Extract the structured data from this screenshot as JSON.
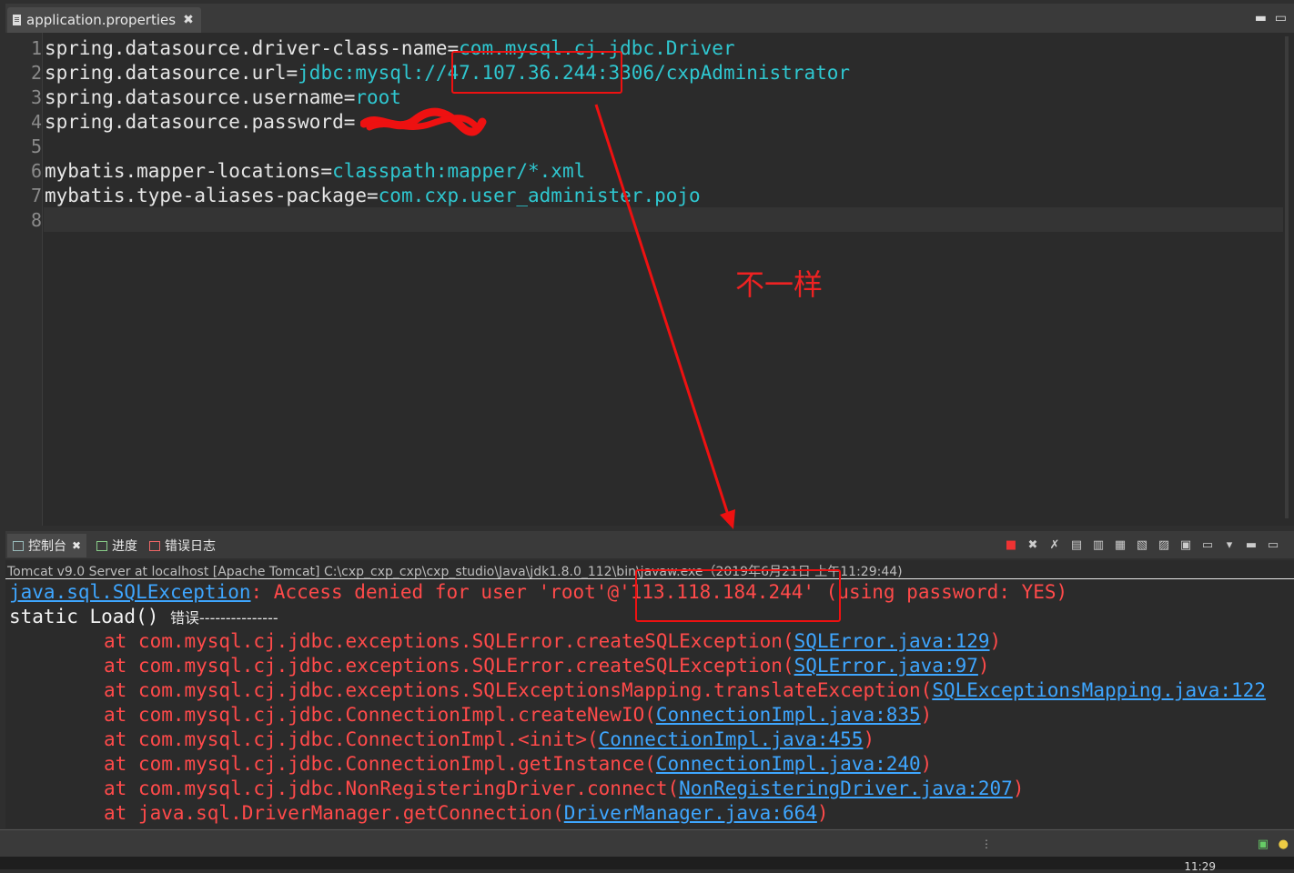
{
  "editor": {
    "tab_label": "application.properties",
    "tab_close": "✖",
    "lines": [
      {
        "num": "1",
        "key": "spring.datasource.driver-class-name=",
        "value": "com.mysql.cj.jdbc.Driver"
      },
      {
        "num": "2",
        "key": "spring.datasource.url=",
        "value": "jdbc:mysql://47.107.36.244:3306/cxpAdministrator"
      },
      {
        "num": "3",
        "key": "spring.datasource.username=",
        "value": "root"
      },
      {
        "num": "4",
        "key": "spring.datasource.password=",
        "value": ""
      },
      {
        "num": "5",
        "key": "",
        "value": ""
      },
      {
        "num": "6",
        "key": "mybatis.mapper-locations=",
        "value": "classpath:mapper/*.xml"
      },
      {
        "num": "7",
        "key": "mybatis.type-aliases-package=",
        "value": "com.cxp.user_administer.pojo"
      },
      {
        "num": "8",
        "key": "",
        "value": ""
      }
    ]
  },
  "annotation": {
    "label": "不一样",
    "color": "#ee1111"
  },
  "console": {
    "tabs": [
      {
        "label": "控制台",
        "close": "✖"
      },
      {
        "label": "进度"
      },
      {
        "label": "错误日志"
      }
    ],
    "header": "Tomcat v9.0 Server at localhost [Apache Tomcat] C:\\cxp_cxp_cxp\\cxp_studio\\Java\\jdk1.8.0_112\\bin\\javaw.exe（2019年6月21日 上午11:29:44)",
    "exception_class": "java.sql.SQLException",
    "exception_message": ": Access denied for user 'root'@'113.118.184.244' (using password: YES)",
    "static_line_code": "static Load() ",
    "static_line_text": "错误---------------",
    "stack": [
      {
        "at": "at com.mysql.cj.jdbc.exceptions.SQLError.createSQLException(",
        "link": "SQLError.java:129",
        "tail": ")"
      },
      {
        "at": "at com.mysql.cj.jdbc.exceptions.SQLError.createSQLException(",
        "link": "SQLError.java:97",
        "tail": ")"
      },
      {
        "at": "at com.mysql.cj.jdbc.exceptions.SQLExceptionsMapping.translateException(",
        "link": "SQLExceptionsMapping.java:122",
        "tail": ""
      },
      {
        "at": "at com.mysql.cj.jdbc.ConnectionImpl.createNewIO(",
        "link": "ConnectionImpl.java:835",
        "tail": ")"
      },
      {
        "at": "at com.mysql.cj.jdbc.ConnectionImpl.<init>(",
        "link": "ConnectionImpl.java:455",
        "tail": ")"
      },
      {
        "at": "at com.mysql.cj.jdbc.ConnectionImpl.getInstance(",
        "link": "ConnectionImpl.java:240",
        "tail": ")"
      },
      {
        "at": "at com.mysql.cj.jdbc.NonRegisteringDriver.connect(",
        "link": "NonRegisteringDriver.java:207",
        "tail": ")"
      },
      {
        "at": "at java.sql.DriverManager.getConnection(",
        "link": "DriverManager.java:664",
        "tail": ")"
      }
    ]
  },
  "status": {
    "clock": "11:29"
  }
}
